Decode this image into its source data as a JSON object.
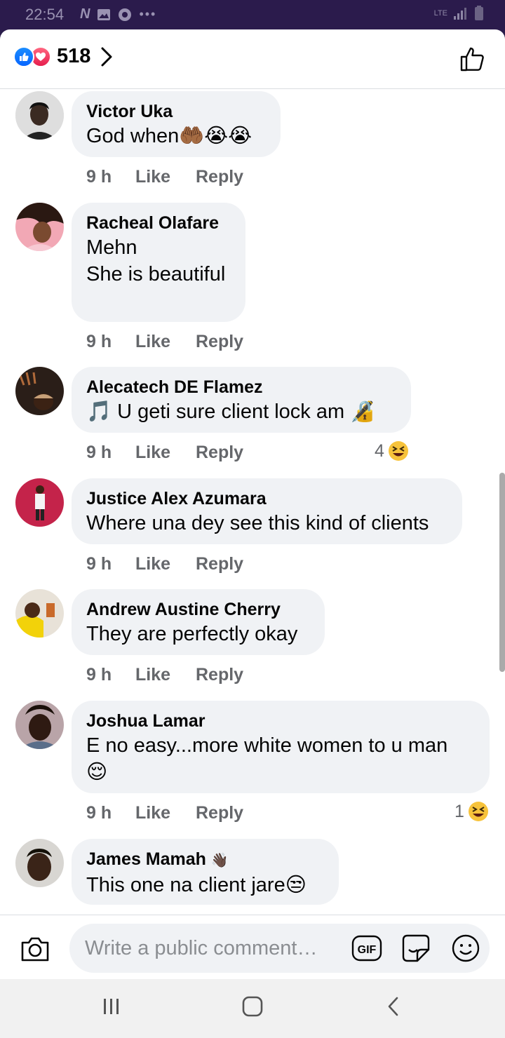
{
  "status_bar": {
    "time": "22:54",
    "network": "LTE"
  },
  "header": {
    "reaction_count": "518"
  },
  "comments": [
    {
      "name": "Victor Uka",
      "lines": [
        "God when🤲🏾😭😭"
      ],
      "time": "9 h",
      "like": "Like",
      "reply": "Reply"
    },
    {
      "name": "Racheal Olafare",
      "lines": [
        "Mehn",
        "She is beautiful"
      ],
      "time": "9 h",
      "like": "Like",
      "reply": "Reply"
    },
    {
      "name": "Alecatech DE Flamez",
      "lines": [
        "🎵 U geti sure client lock am 🔏"
      ],
      "time": "9 h",
      "like": "Like",
      "reply": "Reply",
      "reaction_count": "4",
      "reaction_icon": "laughing-emoji"
    },
    {
      "name": "Justice Alex Azumara",
      "lines": [
        "Where una dey see this kind of clients"
      ],
      "time": "9 h",
      "like": "Like",
      "reply": "Reply"
    },
    {
      "name": "Andrew Austine Cherry",
      "lines": [
        "They are perfectly okay"
      ],
      "time": "9 h",
      "like": "Like",
      "reply": "Reply"
    },
    {
      "name": "Joshua Lamar",
      "lines": [
        "E no easy...more white women to u man",
        "😌"
      ],
      "time": "9 h",
      "like": "Like",
      "reply": "Reply",
      "reaction_count": "1",
      "reaction_icon": "laughing-emoji"
    },
    {
      "name": "James Mamah",
      "name_badge": "👋🏿",
      "lines": [
        "This one na client jare😒"
      ]
    }
  ],
  "composer": {
    "placeholder": "Write a public comment…",
    "gif_label": "GIF"
  },
  "colors": {
    "like_blue": "#0866ff",
    "love_red": "#f33e58",
    "bubble": "#f0f2f5",
    "secondary_text": "#65676b"
  }
}
